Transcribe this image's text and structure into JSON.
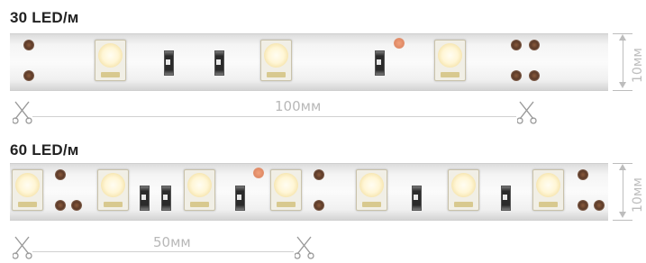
{
  "strip_30": {
    "title": "30 LED/м",
    "length_label": "100мм",
    "width_label": "10мм"
  },
  "strip_60": {
    "title": "60 LED/м",
    "length_label": "50мм",
    "width_label": "10мм"
  }
}
